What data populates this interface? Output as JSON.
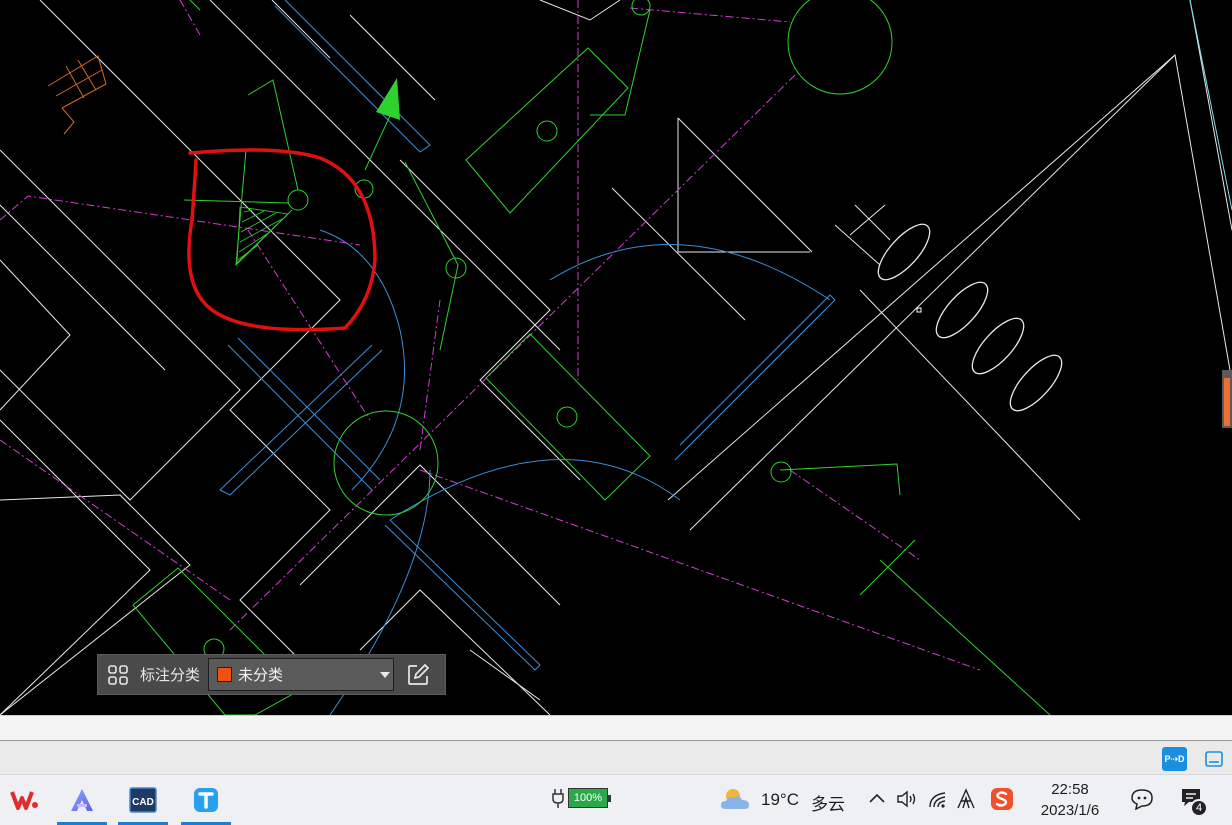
{
  "markup_toolbar": {
    "grid_icon": "grid-icon",
    "label": "标注分类",
    "category_value": "未分类",
    "category_color": "#f0530f",
    "edit_icon": "edit-icon"
  },
  "status_bar": {
    "pd_button_label": "P⇢D",
    "layout_icon": "panel-layout-icon"
  },
  "taskbar": {
    "apps": [
      {
        "name": "wps-office",
        "glyph": "W"
      },
      {
        "name": "a-app",
        "glyph": "A"
      },
      {
        "name": "cad-viewer",
        "glyph": "CAD"
      },
      {
        "name": "t-app",
        "glyph": "T"
      }
    ],
    "battery": "100%",
    "temperature": "19°C",
    "weather": "多云",
    "time": "22:58",
    "date": "2023/1/6",
    "notification_count": "4"
  },
  "colors": {
    "canvas_bg": "#000000",
    "cad_white": "#ffffff",
    "cad_green": "#2fd12f",
    "cad_magenta": "#d53cd5",
    "cad_blue": "#3a8fd8",
    "cad_cyan": "#7fe0e6",
    "cad_orange": "#d9682c",
    "markup_red": "#e01010",
    "taskbar_bg": "#eef0f3"
  }
}
